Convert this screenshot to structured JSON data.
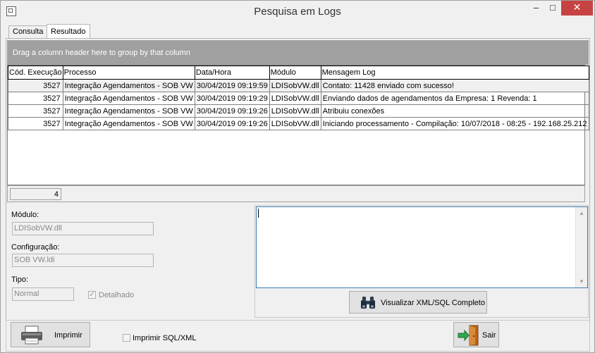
{
  "window": {
    "title": "Pesquisa em Logs",
    "minimize": "‒",
    "maximize": "□",
    "close": "✕"
  },
  "tabs": [
    {
      "label": "Consulta"
    },
    {
      "label": "Resultado"
    }
  ],
  "grid": {
    "group_hint": "Drag a column header here to group by that column",
    "columns": [
      "Cód. Execução",
      "Processo",
      "Data/Hora",
      "Módulo",
      "Mensagem Log"
    ],
    "rows": [
      [
        "3527",
        "Integração Agendamentos - SOB VW",
        "30/04/2019 09:19:59",
        "LDISobVW.dll",
        "Contato: 11428 enviado com sucesso!"
      ],
      [
        "3527",
        "Integração Agendamentos - SOB VW",
        "30/04/2019 09:19:29",
        "LDISobVW.dll",
        "Enviando dados de agendamentos da Empresa: 1 Revenda: 1"
      ],
      [
        "3527",
        "Integração Agendamentos - SOB VW",
        "30/04/2019 09:19:26",
        "LDISobVW.dll",
        "Atribuiu conexões"
      ],
      [
        "3527",
        "Integração Agendamentos - SOB VW",
        "30/04/2019 09:19:26",
        "LDISobVW.dll",
        "Iniciando processamento - Compilação: 10/07/2018 - 08:25 - 192.168.25.212"
      ]
    ],
    "count": "4"
  },
  "details": {
    "modulo_label": "Módulo:",
    "modulo_value": "LDISobVW.dll",
    "config_label": "Configuração:",
    "config_value": "SOB VW.ldi",
    "tipo_label": "Tipo:",
    "tipo_value": "Normal",
    "detalhado_label": "Detalhado"
  },
  "memo": {
    "value": ""
  },
  "buttons": {
    "view_full": "Visualizar XML/SQL Completo",
    "print": "Imprimir",
    "print_sql": "Imprimir SQL/XML",
    "exit": "Sair"
  },
  "icons": {
    "binoculars": "binoculars-icon",
    "printer": "printer-icon",
    "exit": "exit-door-icon"
  }
}
